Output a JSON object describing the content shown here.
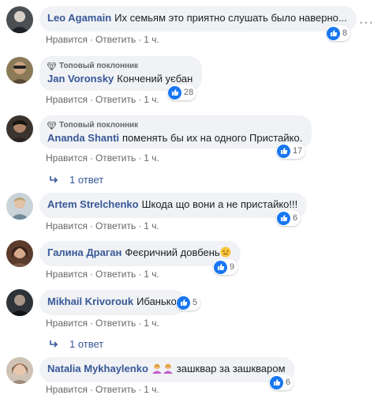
{
  "actions": {
    "like": "Нравится",
    "reply": "Ответить",
    "sep": "·"
  },
  "colors": {
    "bubble": "#f0f2f5",
    "author": "#385898",
    "like_blue": "#1877f2",
    "meta": "#65676b"
  },
  "comments": [
    {
      "author": "Leo Agamain",
      "text": "Их семьям это приятно слушать было наверно...",
      "reactions": "8",
      "time": "1 ч."
    },
    {
      "badge": "Топовый поклонник",
      "author": "Jan Voronsky",
      "text": "Кончений уєбан",
      "reactions": "28",
      "time": "1 ч."
    },
    {
      "badge": "Топовый поклонник",
      "author": "Ananda Shanti",
      "text": "поменять бы их на одного Пристайко.",
      "reactions": "17",
      "time": "1 ч.",
      "replies": "1 ответ"
    },
    {
      "author": "Artem Strelchenko",
      "text": "Шкода що вони а не пристайко!!!",
      "reactions": "6",
      "time": "1 ч."
    },
    {
      "author": "Галина Драган",
      "text": "Феєричний довбень",
      "reactions": "9",
      "time": "1 ч."
    },
    {
      "author": "Mikhail Krivorouk",
      "text": "Ибанько",
      "reactions": "5",
      "time": "1 ч.",
      "replies": "1 ответ"
    },
    {
      "author": "Natalia Mykhaylenko",
      "text": "зашквар за зашкваром",
      "reactions": "6",
      "time": "1 ч."
    }
  ]
}
